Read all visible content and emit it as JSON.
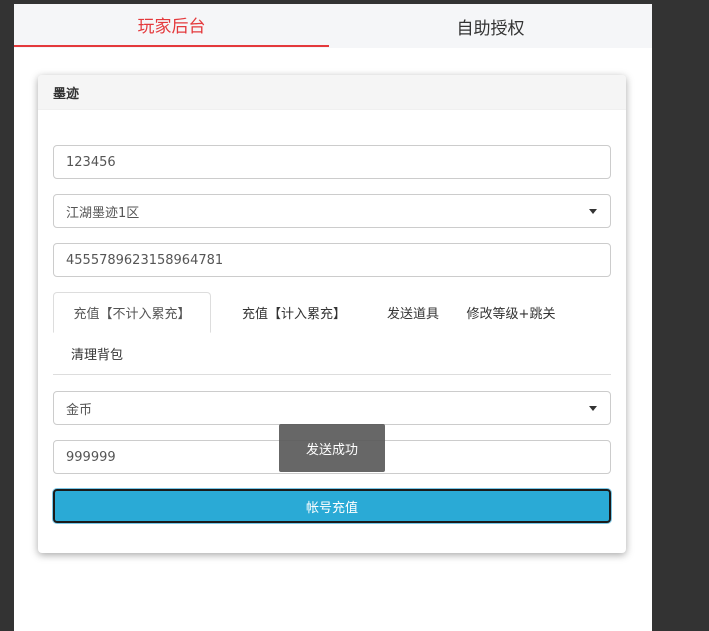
{
  "top_tabs": {
    "player_backend": "玩家后台",
    "self_auth": "自助授权"
  },
  "card": {
    "title": "墨迹",
    "account_value": "123456",
    "server_selected": "江湖墨迹1区",
    "code_value": "4555789623158964781",
    "tabs": [
      "充值【不计入累充】",
      "充值【计入累充】",
      "发送道具",
      "修改等级+跳关",
      "清理背包"
    ],
    "currency_selected": "金币",
    "amount_value": "999999",
    "submit_label": "帐号充值"
  },
  "toast": {
    "message": "发送成功"
  },
  "colors": {
    "accent": "#e4393c",
    "button": "#2aaad6"
  }
}
